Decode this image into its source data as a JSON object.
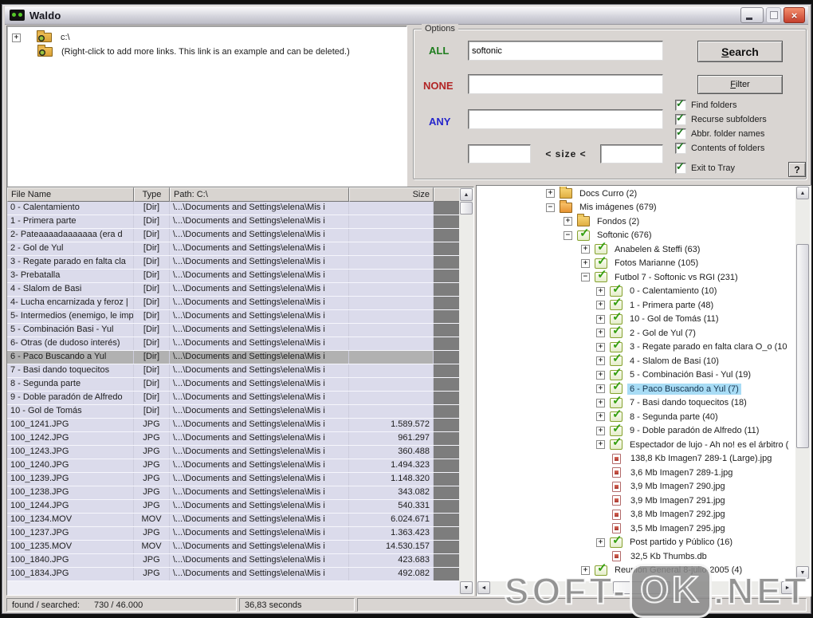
{
  "window": {
    "title": "Waldo"
  },
  "links": {
    "items": [
      {
        "expand": "+",
        "label": "c:\\"
      },
      {
        "expand": "",
        "label": "(Right-click to add more links.  This link is an example and can be deleted.)"
      }
    ]
  },
  "options": {
    "group_label": "Options",
    "all_label": "ALL",
    "all_value": "softonic",
    "none_label": "NONE",
    "none_value": "",
    "any_label": "ANY",
    "any_value": "",
    "size_label": "<  size  <",
    "size_min": "",
    "size_max": "",
    "search_label": "Search",
    "filter_label": "Filter",
    "help_label": "?",
    "colors": {
      "all": "#1e7d1e",
      "none": "#b22525",
      "any": "#2626cc"
    },
    "checkboxes": [
      {
        "label": "Find folders",
        "checked": true
      },
      {
        "label": "Recurse subfolders",
        "checked": true
      },
      {
        "label": "Abbr. folder names",
        "checked": true
      },
      {
        "label": "Contents of folders",
        "checked": true
      },
      {
        "label": "Exit to Tray",
        "checked": true,
        "gap": true
      }
    ]
  },
  "file_list": {
    "columns": [
      "File Name",
      "Type",
      "Path: C:\\",
      "Size"
    ],
    "path_value": "\\...\\Documents and Settings\\elena\\Mis i",
    "selected_row": 11,
    "rows": [
      {
        "name": "0 - Calentamiento",
        "type": "[Dir]",
        "size": ""
      },
      {
        "name": "1 - Primera parte",
        "type": "[Dir]",
        "size": ""
      },
      {
        "name": "2- Pateaaaadaaaaaaa (era d",
        "type": "[Dir]",
        "size": ""
      },
      {
        "name": "2 - Gol de Yul",
        "type": "[Dir]",
        "size": ""
      },
      {
        "name": "3 - Regate parado en falta cla",
        "type": "[Dir]",
        "size": ""
      },
      {
        "name": "3- Prebatalla",
        "type": "[Dir]",
        "size": ""
      },
      {
        "name": "4 - Slalom de Basi",
        "type": "[Dir]",
        "size": ""
      },
      {
        "name": "4- Lucha encarnizada y feroz |",
        "type": "[Dir]",
        "size": ""
      },
      {
        "name": "5- Intermedios (enemigo, le imp",
        "type": "[Dir]",
        "size": ""
      },
      {
        "name": "5 - Combinación Basi - Yul",
        "type": "[Dir]",
        "size": ""
      },
      {
        "name": "6- Otras (de dudoso interés)",
        "type": "[Dir]",
        "size": ""
      },
      {
        "name": "6 - Paco Buscando a Yul",
        "type": "[Dir]",
        "size": ""
      },
      {
        "name": "7 - Basi dando toquecitos",
        "type": "[Dir]",
        "size": ""
      },
      {
        "name": "8 - Segunda parte",
        "type": "[Dir]",
        "size": ""
      },
      {
        "name": "9 - Doble paradón de Alfredo",
        "type": "[Dir]",
        "size": ""
      },
      {
        "name": "10 - Gol de Tomás",
        "type": "[Dir]",
        "size": ""
      },
      {
        "name": "100_1241.JPG",
        "type": "JPG",
        "size": "1.589.572"
      },
      {
        "name": "100_1242.JPG",
        "type": "JPG",
        "size": "961.297"
      },
      {
        "name": "100_1243.JPG",
        "type": "JPG",
        "size": "360.488"
      },
      {
        "name": "100_1240.JPG",
        "type": "JPG",
        "size": "1.494.323"
      },
      {
        "name": "100_1239.JPG",
        "type": "JPG",
        "size": "1.148.320"
      },
      {
        "name": "100_1238.JPG",
        "type": "JPG",
        "size": "343.082"
      },
      {
        "name": "100_1244.JPG",
        "type": "JPG",
        "size": "540.331"
      },
      {
        "name": "100_1234.MOV",
        "type": "MOV",
        "size": "6.024.671"
      },
      {
        "name": "100_1237.JPG",
        "type": "JPG",
        "size": "1.363.423"
      },
      {
        "name": "100_1235.MOV",
        "type": "MOV",
        "size": "14.530.157"
      },
      {
        "name": "100_1840.JPG",
        "type": "JPG",
        "size": "423.683"
      },
      {
        "name": "100_1834.JPG",
        "type": "JPG",
        "size": "492.082"
      }
    ]
  },
  "folder_tree": {
    "nodes": [
      {
        "level": 0,
        "expand": "+",
        "icon": "folder",
        "label": "Docs Curro (2)"
      },
      {
        "level": 0,
        "expand": "-",
        "icon": "folder-open",
        "label": "Mis imágenes (679)"
      },
      {
        "level": 1,
        "expand": "+",
        "icon": "folder",
        "label": "Fondos (2)"
      },
      {
        "level": 1,
        "expand": "-",
        "icon": "folder-check",
        "label": "Softonic (676)"
      },
      {
        "level": 2,
        "expand": "+",
        "icon": "folder-check",
        "label": "Anabelen & Steffi (63)"
      },
      {
        "level": 2,
        "expand": "+",
        "icon": "folder-check",
        "label": "Fotos Marianne (105)"
      },
      {
        "level": 2,
        "expand": "-",
        "icon": "folder-check",
        "label": "Futbol 7 - Softonic vs RGI (231)"
      },
      {
        "level": 3,
        "expand": "+",
        "icon": "folder-check",
        "label": "0 - Calentamiento (10)"
      },
      {
        "level": 3,
        "expand": "+",
        "icon": "folder-check",
        "label": "1 - Primera parte (48)"
      },
      {
        "level": 3,
        "expand": "+",
        "icon": "folder-check",
        "label": "10 - Gol de Tomás (11)"
      },
      {
        "level": 3,
        "expand": "+",
        "icon": "folder-check",
        "label": "2 - Gol de Yul (7)"
      },
      {
        "level": 3,
        "expand": "+",
        "icon": "folder-check",
        "label": "3 - Regate parado en falta clara O_o (10"
      },
      {
        "level": 3,
        "expand": "+",
        "icon": "folder-check",
        "label": "4 - Slalom de Basi (10)"
      },
      {
        "level": 3,
        "expand": "+",
        "icon": "folder-check",
        "label": "5 - Combinación Basi - Yul (19)"
      },
      {
        "level": 3,
        "expand": "+",
        "icon": "folder-check",
        "label": "6 - Paco Buscando a Yul (7)",
        "selected": true
      },
      {
        "level": 3,
        "expand": "+",
        "icon": "folder-check",
        "label": "7 - Basi dando toquecitos (18)"
      },
      {
        "level": 3,
        "expand": "+",
        "icon": "folder-check",
        "label": "8 - Segunda parte (40)"
      },
      {
        "level": 3,
        "expand": "+",
        "icon": "folder-check",
        "label": "9 - Doble paradón de Alfredo (11)"
      },
      {
        "level": 3,
        "expand": "+",
        "icon": "folder-check",
        "label": "Espectador de lujo - Ah no! es el árbitro ("
      },
      {
        "level": 4,
        "expand": "",
        "icon": "file",
        "label": "138,8 Kb  Imagen7 289-1 (Large).jpg"
      },
      {
        "level": 4,
        "expand": "",
        "icon": "file",
        "label": "3,6 Mb  Imagen7 289-1.jpg"
      },
      {
        "level": 4,
        "expand": "",
        "icon": "file",
        "label": "3,9 Mb  Imagen7 290.jpg"
      },
      {
        "level": 4,
        "expand": "",
        "icon": "file",
        "label": "3,9 Mb  Imagen7 291.jpg"
      },
      {
        "level": 4,
        "expand": "",
        "icon": "file",
        "label": "3,8 Mb  Imagen7 292.jpg"
      },
      {
        "level": 4,
        "expand": "",
        "icon": "file",
        "label": "3,5 Mb  Imagen7 295.jpg"
      },
      {
        "level": 3,
        "expand": "+",
        "icon": "folder-check",
        "label": "Post partido y Público (16)"
      },
      {
        "level": 4,
        "expand": "",
        "icon": "file",
        "label": "32,5 Kb  Thumbs.db"
      },
      {
        "level": 2,
        "expand": "+",
        "icon": "folder-check",
        "label": "Reunión General 8-julio-2005 (4)"
      }
    ]
  },
  "statusbar": {
    "found_label": "found / searched:",
    "found_value": "730 / 46.000",
    "time_value": "36,83 seconds",
    "extra_value": ""
  },
  "watermark": {
    "part1": "SOFT-",
    "badge": "OK",
    "part3": ".NET"
  }
}
